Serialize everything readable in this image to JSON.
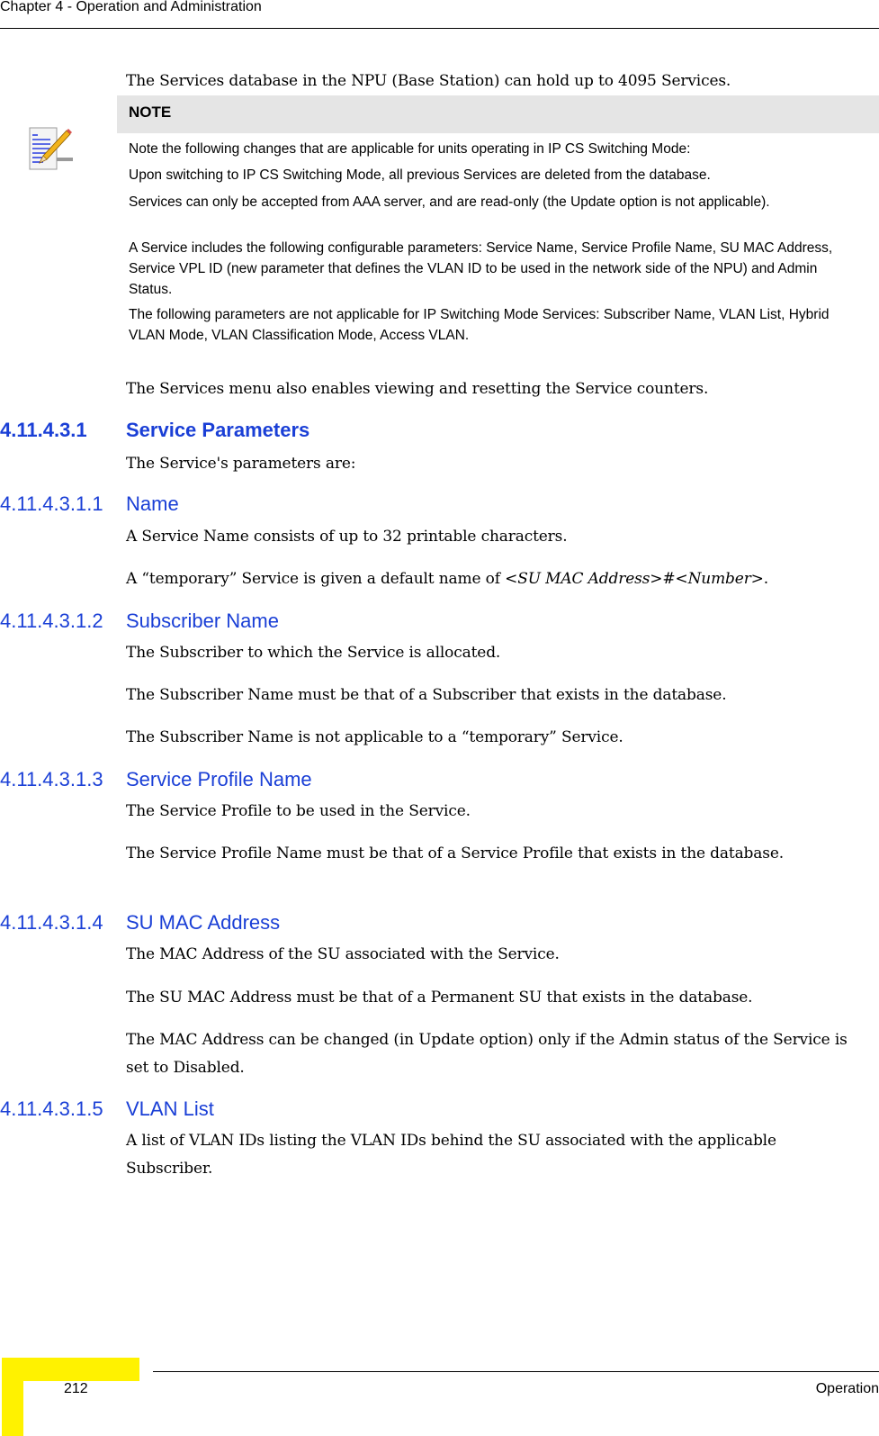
{
  "header": {
    "chapter_title": "Chapter 4 - Operation and Administration"
  },
  "intro": {
    "capacity_text": "The Services database in the NPU (Base Station) can hold up to 4095 Services."
  },
  "note": {
    "icon": "note-pencil-icon",
    "label": "NOTE",
    "lines": [
      "Note the following changes that are applicable for units operating in IP CS Switching Mode:",
      "Upon switching to IP CS Switching Mode, all previous Services are deleted from the database.",
      "Services can only be accepted from AAA server, and are read-only (the Update option is not applicable).",
      "A Service includes the following configurable parameters: Service Name, Service Profile Name, SU MAC Address, Service VPL ID (new parameter that defines the VLAN ID to be used in the network side of the NPU) and Admin Status.",
      "The following parameters are not applicable for IP Switching Mode Services: Subscriber Name, VLAN List, Hybrid VLAN Mode, VLAN Classification Mode, Access VLAN."
    ]
  },
  "counters_text": "The Services menu also enables viewing and resetting the Service counters.",
  "section": {
    "number": "4.11.4.3.1",
    "title": "Service Parameters",
    "intro": "The Service's parameters are:"
  },
  "subsections": [
    {
      "number": "4.11.4.3.1.1",
      "title": "Name",
      "paragraphs": [
        "A Service Name consists of up to 32 printable characters."
      ],
      "temp_name": {
        "prefix": "A “temporary” Service is given a default name of ",
        "pattern": "<SU MAC Address>#<Number>",
        "suffix": "."
      }
    },
    {
      "number": "4.11.4.3.1.2",
      "title": "Subscriber Name",
      "paragraphs": [
        "The Subscriber to which the Service is allocated.",
        "The Subscriber Name must be that of a Subscriber that exists in the database.",
        "The Subscriber Name is not applicable to a “temporary” Service."
      ]
    },
    {
      "number": "4.11.4.3.1.3",
      "title": "Service Profile Name",
      "paragraphs": [
        "The Service Profile to be used in the Service.",
        "The Service Profile Name must be that of a Service Profile that exists in the database."
      ]
    },
    {
      "number": "4.11.4.3.1.4",
      "title": "SU MAC Address",
      "paragraphs": [
        "The MAC Address of the SU associated with the Service.",
        "The SU MAC Address must be that of a Permanent SU that exists in the database.",
        "The MAC Address can be changed (in Update option) only if the Admin status of the Service is set to Disabled."
      ]
    },
    {
      "number": "4.11.4.3.1.5",
      "title": "VLAN List",
      "paragraphs": [
        "A list of VLAN IDs listing the VLAN IDs behind the SU associated with the applicable Subscriber."
      ]
    }
  ],
  "footer": {
    "page_number": "212",
    "section_name": "Operation"
  },
  "colors": {
    "heading_blue": "#1a3fd6",
    "note_header_bg": "#e5e5e5",
    "footer_yellow": "#fff200"
  }
}
